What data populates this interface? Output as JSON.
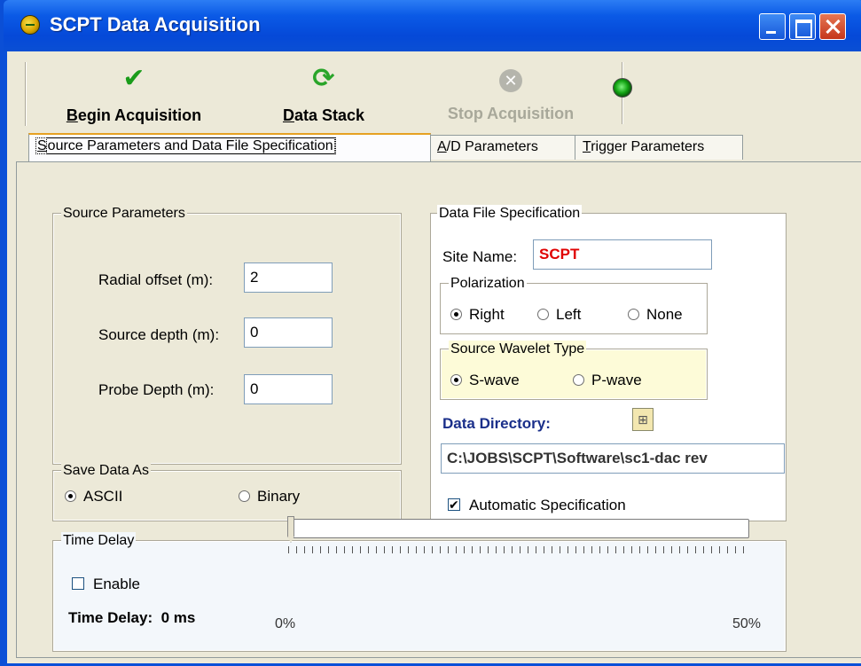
{
  "window": {
    "title": "SCPT Data Acquisition"
  },
  "toolbar": {
    "begin": {
      "label_u": "B",
      "label_rest": "egin Acquisition",
      "icon": "checkmark-icon"
    },
    "stack": {
      "label_u": "D",
      "label_rest": "ata Stack",
      "icon": "refresh-icon"
    },
    "stop": {
      "label": "Stop Acquisition",
      "icon": "stop-circle-icon",
      "enabled": false
    },
    "status_led": {
      "icon": "green-led-icon",
      "color": "#12a312"
    }
  },
  "tabs": [
    {
      "label_u": "S",
      "label_rest": "ource Parameters and Data File Specification",
      "active": true
    },
    {
      "label_u": "A",
      "label_rest": "/D Parameters",
      "active": false
    },
    {
      "label_u": "T",
      "label_rest": "rigger Parameters",
      "active": false
    }
  ],
  "source_parameters": {
    "title": "Source Parameters",
    "radial_offset": {
      "label": "Radial offset (m):",
      "value": "2"
    },
    "source_depth": {
      "label": "Source depth (m):",
      "value": "0"
    },
    "probe_depth": {
      "label": "Probe Depth (m):",
      "value": "0"
    }
  },
  "save_data_as": {
    "title": "Save Data As",
    "options": [
      "ASCII",
      "Binary"
    ],
    "selected": "ASCII"
  },
  "data_file_spec": {
    "title": "Data File Specification",
    "site_name": {
      "label": "Site Name:",
      "value": "SCPT",
      "color": "#e00000"
    },
    "polarization": {
      "title": "Polarization",
      "options": [
        "Right",
        "Left",
        "None"
      ],
      "selected": "Right"
    },
    "wavelet": {
      "title": "Source Wavelet Type",
      "options": [
        "S-wave",
        "P-wave"
      ],
      "selected": "S-wave"
    },
    "data_directory": {
      "label": "Data Directory:",
      "value": "C:\\JOBS\\SCPT\\Software\\sc1-dac rev",
      "color": "#1a2f8a",
      "icon": "folder-browse-icon"
    },
    "automatic": {
      "label": "Automatic Specification",
      "checked": true
    }
  },
  "time_delay": {
    "title": "Time Delay",
    "enable": {
      "label": "Enable",
      "checked": false
    },
    "readout_label": "Time Delay:",
    "readout_value": "0 ms",
    "slider": {
      "min_label": "0%",
      "max_label": "50%",
      "value": 0
    }
  }
}
